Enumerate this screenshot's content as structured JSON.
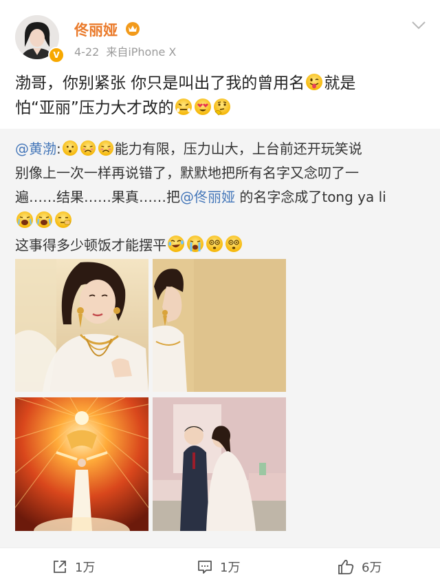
{
  "user": {
    "name": "佟丽娅",
    "date": "4-22",
    "source": "来自iPhone X",
    "verified_mark": "V"
  },
  "post": {
    "line1_a": "渤哥，你别紧张 你只是叫出了我的曾用名",
    "line1_b": "就是",
    "line2_a": "怕“亚丽”压力大才改的"
  },
  "repost": {
    "mention_author": "@黄渤",
    "colon": ":",
    "line1_tail": "能力有限，压力山大，上台前还开玩笑说",
    "line2": "别像上一次一样再说错了，默默地把所有名字又念叨了一",
    "line3_a": "遍……结果……果真……把",
    "mention_target": "@佟丽娅",
    "line3_b": " 的名字念成了tong ya li",
    "line5": "这事得多少顿饭才能摆平"
  },
  "actions": {
    "repost_count": "1万",
    "comment_count": "1万",
    "like_count": "6万"
  },
  "icons": [
    "vip-crown-icon",
    "chevron-down-icon",
    "share-icon",
    "comment-icon",
    "thumbs-up-icon"
  ],
  "colors": {
    "username": "#ea7a2a",
    "mention": "#4577b9",
    "repost_background": "#f4f4f4",
    "meta_text": "#9a9a9a"
  }
}
